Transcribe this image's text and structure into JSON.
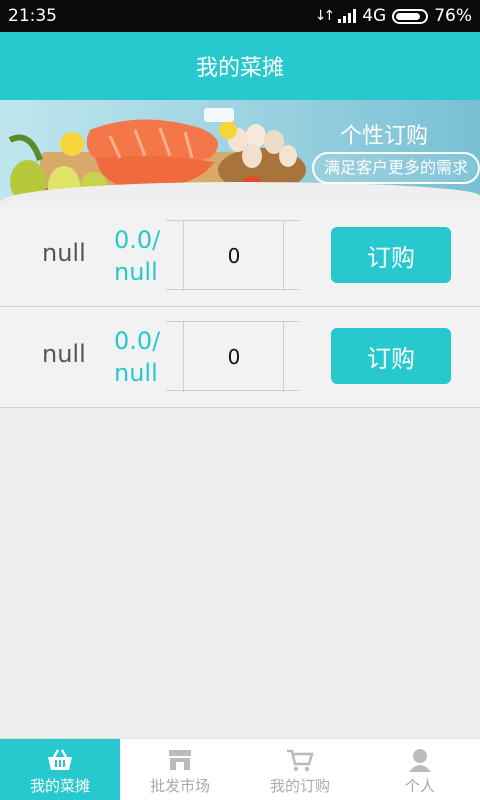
{
  "status_bar": {
    "time": "21:35",
    "network": "4G",
    "battery": "76%"
  },
  "header": {
    "title": "我的菜摊"
  },
  "banner": {
    "title": "个性订购",
    "subtitle": "满足客户更多的需求"
  },
  "products": [
    {
      "name": "null",
      "price_line1": "0.0/",
      "price_line2": "null",
      "quantity": "0",
      "order_label": "订购"
    },
    {
      "name": "null",
      "price_line1": "0.0/",
      "price_line2": "null",
      "quantity": "0",
      "order_label": "订购"
    }
  ],
  "bottom_nav": {
    "tabs": [
      {
        "label": "我的菜摊",
        "icon": "basket-icon",
        "active": true
      },
      {
        "label": "批发市场",
        "icon": "store-icon",
        "active": false
      },
      {
        "label": "我的订购",
        "icon": "cart-icon",
        "active": false
      },
      {
        "label": "个人",
        "icon": "person-icon",
        "active": false
      }
    ]
  },
  "colors": {
    "accent": "#27c9cf",
    "status_bar": "#0a0a0a",
    "background": "#efefef"
  }
}
